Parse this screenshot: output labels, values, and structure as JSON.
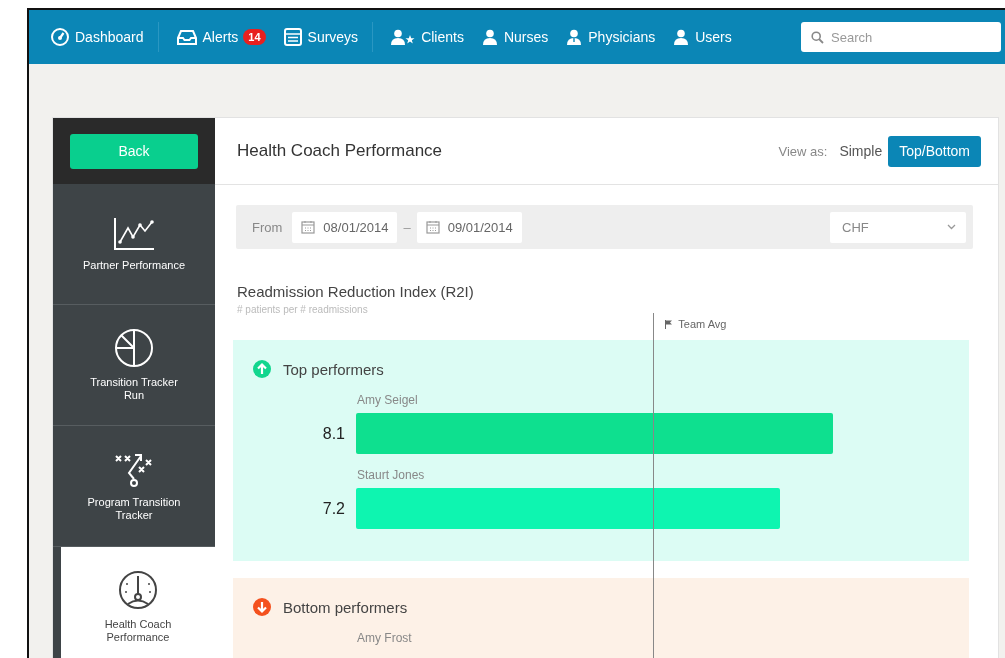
{
  "nav": {
    "items": [
      {
        "label": "Dashboard"
      },
      {
        "label": "Alerts",
        "badge": "14"
      },
      {
        "label": "Surveys"
      },
      {
        "label": "Clients"
      },
      {
        "label": "Nurses"
      },
      {
        "label": "Physicians"
      },
      {
        "label": "Users"
      }
    ],
    "search": {
      "placeholder": "Search"
    }
  },
  "sidebar": {
    "back": "Back",
    "items": [
      {
        "label": "Partner Performance",
        "selected": false
      },
      {
        "label": "Transition Tracker Run",
        "selected": false
      },
      {
        "label": "Program Transition Tracker",
        "selected": false
      },
      {
        "label": "Health Coach Performance",
        "selected": true
      }
    ]
  },
  "title": "Health Coach Performance",
  "view": {
    "label": "View as:",
    "options": [
      {
        "label": "Simple",
        "selected": false
      },
      {
        "label": "Top/Bottom",
        "selected": true
      }
    ]
  },
  "filter": {
    "from_label": "From",
    "start": "08/01/2014",
    "separator": "–",
    "end": "09/01/2014",
    "condition": "CHF"
  },
  "metric": {
    "title": "Readmission Reduction Index (R2I)",
    "subtitle": "# patients per # readmissions",
    "team_avg_label": "Team Avg"
  },
  "groups": [
    {
      "kind": "top",
      "title": "Top performers",
      "performers": [
        {
          "name": "Amy Seigel",
          "value": "8.1"
        },
        {
          "name": "Staurt Jones",
          "value": "7.2"
        }
      ]
    },
    {
      "kind": "bottom",
      "title": "Bottom performers",
      "performers": [
        {
          "name": "Amy Frost"
        }
      ]
    }
  ]
}
